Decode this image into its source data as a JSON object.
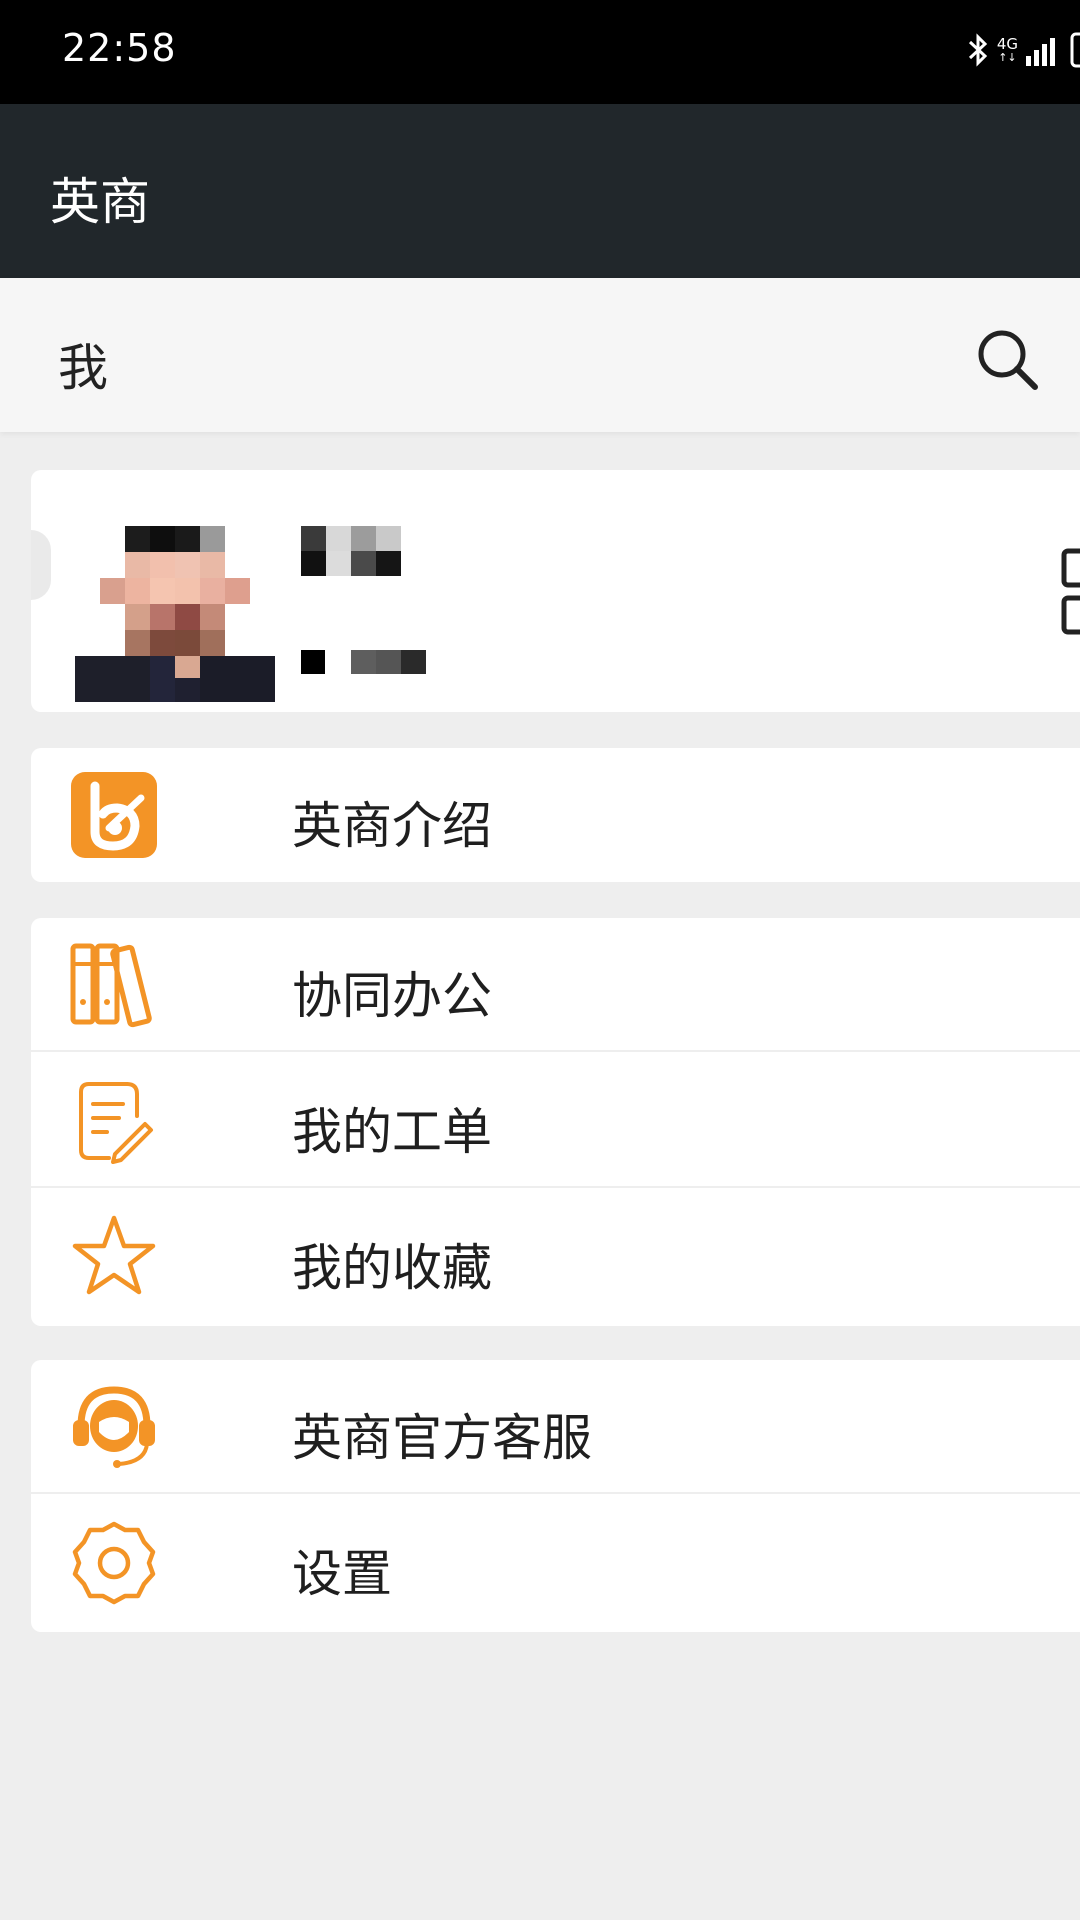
{
  "status_bar": {
    "time": "22:58",
    "icons": [
      "bluetooth-icon",
      "4g-icon",
      "signal-icon",
      "battery-icon"
    ],
    "network_label": "4G"
  },
  "app_bar": {
    "title": "英商"
  },
  "sub_header": {
    "title": "我",
    "search_icon": "search-icon"
  },
  "profile": {
    "avatar": "avatar-pixelated",
    "name": "",
    "subtitle": "",
    "qr_icon": "qr-code-icon"
  },
  "menu": {
    "intro": {
      "label": "英商介绍",
      "icon": "ying-shang-logo-icon"
    },
    "collab": {
      "label": "协同办公",
      "icon": "binders-icon"
    },
    "work_orders": {
      "label": "我的工单",
      "icon": "edit-document-icon"
    },
    "favorites": {
      "label": "我的收藏",
      "icon": "star-icon"
    },
    "support": {
      "label": "英商官方客服",
      "icon": "customer-service-icon"
    },
    "settings": {
      "label": "设置",
      "icon": "gear-icon"
    }
  },
  "colors": {
    "accent": "#f39426",
    "app_bar_bg": "#21272b",
    "status_bar_bg": "#000000",
    "page_bg": "#eeeeee"
  }
}
